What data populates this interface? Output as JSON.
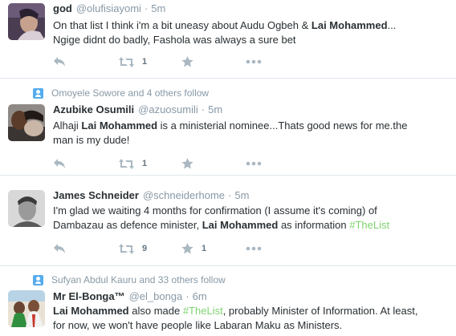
{
  "tweets": [
    {
      "context": "",
      "fullname": "god",
      "username": "@olufisiayomi",
      "separator": "·",
      "time": "5m",
      "text_parts": [
        "On that list I think i'm a bit uneasy about Audu Ogbeh & ",
        "Lai Mohammed",
        "...",
        "Ngige didnt do badly, Fashola was always a sure bet"
      ],
      "retweets": "1",
      "favorites": ""
    },
    {
      "context": "Omoyele Sowore and 4 others follow",
      "fullname": "Azubike Osumili",
      "username": "@azuosumili",
      "separator": "·",
      "time": "5m",
      "text_parts": [
        "Alhaji ",
        "Lai Mohammed",
        " is a ministerial nominee...Thats good news for me.the",
        "man is my dude!"
      ],
      "retweets": "1",
      "favorites": ""
    },
    {
      "context": "",
      "fullname": "James Schneider",
      "username": "@schneiderhome",
      "separator": "·",
      "time": "5m",
      "text_parts": [
        "I'm glad we waiting 4 months for confirmation (I assume it's coming) of",
        "Dambazau as defence minister, ",
        "Lai Mohammed",
        " as information ",
        "#TheList"
      ],
      "retweets": "9",
      "favorites": "1"
    },
    {
      "context": "Sufyan Abdul Kauru and 33 others follow",
      "fullname": "Mr El-Bonga™",
      "username": "@el_bonga",
      "separator": "·",
      "time": "6m",
      "text_parts": [
        "Lai Mohammed",
        " also made ",
        "#TheList",
        ", probably Minister of Information. At least,",
        "for now, we won't have people like Labaran Maku as Ministers."
      ],
      "retweets": "",
      "favorites": ""
    }
  ],
  "colors": {
    "accent": "#55acee",
    "hashtag": "#7ed36e",
    "muted": "#8899a6",
    "icon": "#aab8c2",
    "text": "#292f33",
    "border": "#e1e8ed"
  },
  "icons": {
    "context": "person-follow-icon",
    "reply": "reply-icon",
    "retweet": "retweet-icon",
    "favorite": "star-icon",
    "more": "more-icon"
  }
}
